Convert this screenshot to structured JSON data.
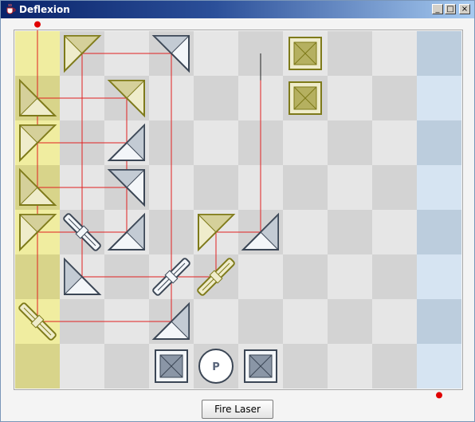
{
  "window": {
    "title": "Deflexion",
    "minimize_glyph": "_",
    "maximize_glyph": "□",
    "close_glyph": "×"
  },
  "board": {
    "cols": 10,
    "rows": 8,
    "colors": {
      "light": "#e6e6e6",
      "dark": "#d3d3d3",
      "gold_zone_light": "#f0eda0",
      "gold_zone_dark": "#d8d48a",
      "blue_zone_light": "#d6e4f2",
      "blue_zone_dark": "#bccddd",
      "laser": "#e02020",
      "gold_piece_fill": "#efeccb",
      "gold_piece_stroke": "#7e7a1a",
      "silver_piece_fill": "#f3f6f9",
      "silver_piece_stroke": "#3b4655",
      "laser_dot": "#e00000"
    },
    "pieces": [
      {
        "col": 1,
        "row": 0,
        "team": "gold",
        "type": "pyramid",
        "corner": "ul"
      },
      {
        "col": 3,
        "row": 0,
        "team": "silver",
        "type": "pyramid",
        "corner": "ur"
      },
      {
        "col": 6,
        "row": 0,
        "team": "gold",
        "type": "obelisk"
      },
      {
        "col": 0,
        "row": 1,
        "team": "gold",
        "type": "pyramid",
        "corner": "ll"
      },
      {
        "col": 2,
        "row": 1,
        "team": "gold",
        "type": "pyramid",
        "corner": "ur"
      },
      {
        "col": 6,
        "row": 1,
        "team": "gold",
        "type": "obelisk"
      },
      {
        "col": 0,
        "row": 2,
        "team": "gold",
        "type": "pyramid",
        "corner": "ul"
      },
      {
        "col": 2,
        "row": 2,
        "team": "silver",
        "type": "pyramid",
        "corner": "lr"
      },
      {
        "col": 0,
        "row": 3,
        "team": "gold",
        "type": "pyramid",
        "corner": "ll"
      },
      {
        "col": 2,
        "row": 3,
        "team": "silver",
        "type": "pyramid",
        "corner": "ur"
      },
      {
        "col": 0,
        "row": 4,
        "team": "gold",
        "type": "pyramid",
        "corner": "ul"
      },
      {
        "col": 1,
        "row": 4,
        "team": "silver",
        "type": "djed",
        "orient": "back"
      },
      {
        "col": 2,
        "row": 4,
        "team": "silver",
        "type": "pyramid",
        "corner": "lr"
      },
      {
        "col": 4,
        "row": 4,
        "team": "gold",
        "type": "pyramid",
        "corner": "ul"
      },
      {
        "col": 5,
        "row": 4,
        "team": "silver",
        "type": "pyramid",
        "corner": "lr"
      },
      {
        "col": 1,
        "row": 5,
        "team": "silver",
        "type": "pyramid",
        "corner": "ll"
      },
      {
        "col": 3,
        "row": 5,
        "team": "silver",
        "type": "djed",
        "orient": "fwd"
      },
      {
        "col": 4,
        "row": 5,
        "team": "gold",
        "type": "djed",
        "orient": "fwd"
      },
      {
        "col": 0,
        "row": 6,
        "team": "gold",
        "type": "djed",
        "orient": "back"
      },
      {
        "col": 3,
        "row": 6,
        "team": "silver",
        "type": "pyramid",
        "corner": "lr"
      },
      {
        "col": 3,
        "row": 7,
        "team": "silver",
        "type": "obelisk"
      },
      {
        "col": 4,
        "row": 7,
        "team": "silver",
        "type": "pharaoh",
        "label": "P"
      },
      {
        "col": 5,
        "row": 7,
        "team": "silver",
        "type": "obelisk"
      }
    ],
    "laser_paths": [
      [
        [
          0.5,
          -0.15
        ],
        [
          0.5,
          1.5
        ],
        [
          2.5,
          1.5
        ],
        [
          2.5,
          4.5
        ],
        [
          0.5,
          4.5
        ],
        [
          0.5,
          1.5
        ]
      ],
      [
        [
          0.5,
          2.5
        ],
        [
          2.5,
          2.5
        ],
        [
          2.5,
          3.5
        ],
        [
          0.5,
          3.5
        ],
        [
          0.5,
          6.5
        ],
        [
          3.5,
          6.5
        ],
        [
          3.5,
          0.5
        ],
        [
          1.5,
          0.5
        ],
        [
          1.5,
          5.5
        ],
        [
          4.5,
          5.5
        ],
        [
          4.5,
          4.5
        ],
        [
          5.5,
          4.5
        ],
        [
          5.5,
          0.5
        ]
      ]
    ],
    "laser_sources": [
      {
        "col": 0.5,
        "row": -0.15
      },
      {
        "col": 9.5,
        "row": 8.15
      }
    ]
  },
  "controls": {
    "fire_label": "Fire Laser"
  }
}
